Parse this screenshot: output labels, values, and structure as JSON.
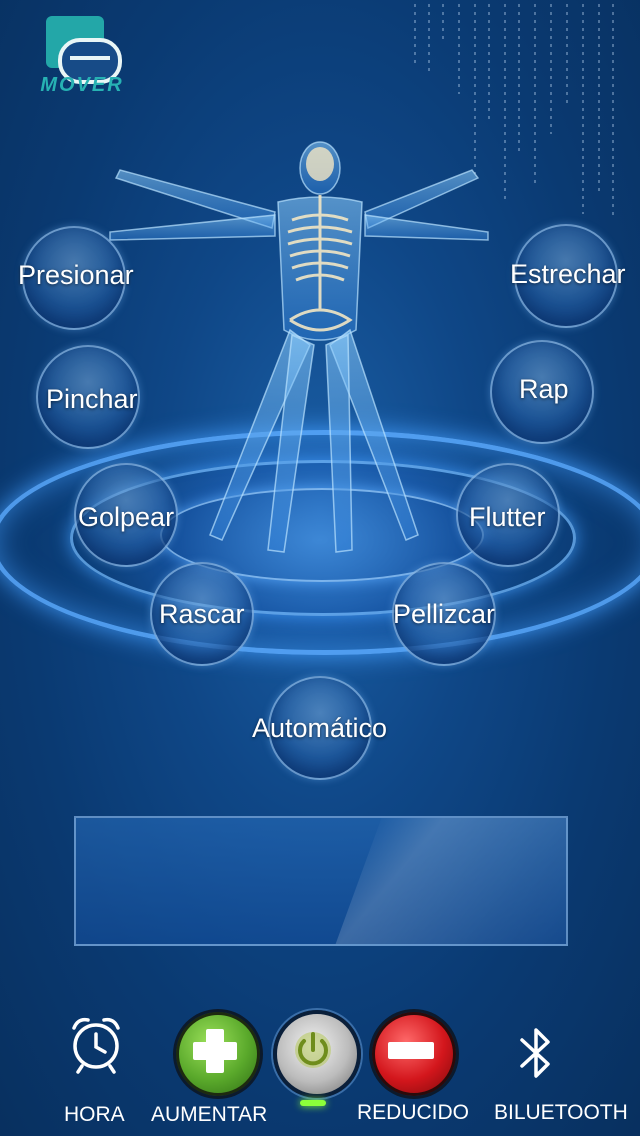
{
  "brand": {
    "logo_text": "MOVER"
  },
  "modes": [
    {
      "id": "presionar",
      "label": "Presionar"
    },
    {
      "id": "estrechar",
      "label": "Estrechar"
    },
    {
      "id": "pinchar",
      "label": "Pinchar"
    },
    {
      "id": "rap",
      "label": "Rap"
    },
    {
      "id": "golpear",
      "label": "Golpear"
    },
    {
      "id": "flutter",
      "label": "Flutter"
    },
    {
      "id": "rascar",
      "label": "Rascar"
    },
    {
      "id": "pellizcar",
      "label": "Pellizcar"
    },
    {
      "id": "automatico",
      "label": "Automático"
    }
  ],
  "display": {
    "text": ""
  },
  "toolbar": {
    "hora_label": "HORA",
    "aumentar_label": "AUMENTAR",
    "reducido_label": "REDUCIDO",
    "bluetooth_label": "BILUETOOTH"
  },
  "colors": {
    "accent_teal": "#23a7a8",
    "plus_green": "#5aa92b",
    "minus_red": "#d3161c",
    "power_led": "#8cff3a"
  }
}
